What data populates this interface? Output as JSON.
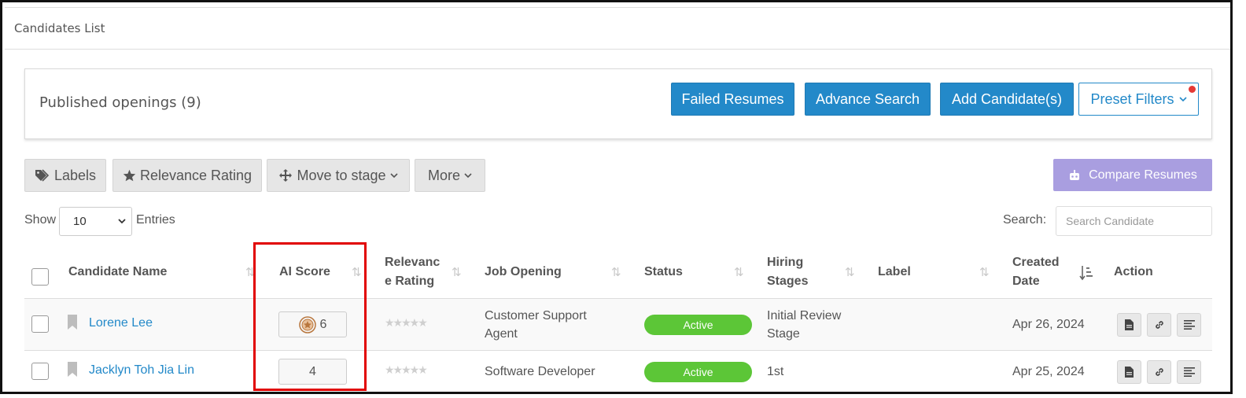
{
  "panel": {
    "title": "Candidates List"
  },
  "openings": {
    "title": "Published openings (9)"
  },
  "top_buttons": {
    "failed": "Failed Resumes",
    "advance": "Advance Search",
    "add": "Add Candidate(s)",
    "preset": "Preset Filters"
  },
  "toolbar": {
    "labels": "Labels",
    "relevance": "Relevance Rating",
    "move": "Move to stage",
    "more": "More",
    "compare": "Compare Resumes"
  },
  "entries": {
    "show": "Show",
    "value": "10",
    "entries": "Entries",
    "search_label": "Search:",
    "search_placeholder": "Search Candidate"
  },
  "table": {
    "headers": {
      "name": "Candidate Name",
      "ai": "AI Score",
      "rel_1": "Relevanc",
      "rel_2": "e Rating",
      "job": "Job Opening",
      "status": "Status",
      "hiring_1": "Hiring",
      "hiring_2": "Stages",
      "label": "Label",
      "created_1": "Created",
      "created_2": "Date",
      "action": "Action"
    },
    "rows": [
      {
        "name": "Lorene Lee",
        "ai_score": "6",
        "job_1": "Customer Support",
        "job_2": "Agent",
        "status": "Active",
        "stage_1": "Initial Review",
        "stage_2": "Stage",
        "date": "Apr 26, 2024"
      },
      {
        "name": "Jacklyn Toh Jia Lin",
        "ai_score": "4",
        "job_1": "Software Developer",
        "status": "Active",
        "stage_1": "1st",
        "date": "Apr 25, 2024"
      }
    ]
  },
  "colors": {
    "primary": "#2389c9",
    "active": "#5cc637",
    "compare": "#a99ee0",
    "highlight": "#e10000"
  }
}
